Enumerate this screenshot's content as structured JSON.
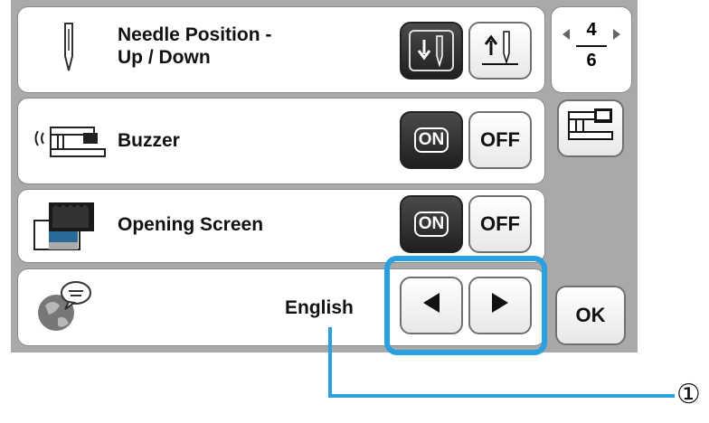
{
  "rows": {
    "needle": {
      "label_line1": "Needle Position -",
      "label_line2": "Up / Down"
    },
    "buzzer": {
      "label": "Buzzer",
      "on": "ON",
      "off": "OFF"
    },
    "opening": {
      "label": "Opening Screen",
      "on": "ON",
      "off": "OFF"
    },
    "language": {
      "value": "English"
    }
  },
  "page": {
    "current": "4",
    "total": "6"
  },
  "ok_label": "OK",
  "callout": {
    "number": "①"
  },
  "colors": {
    "highlight": "#2aa0e0",
    "screen_bg": "#a9a9a9",
    "dark_button": "#2a2a2a"
  },
  "icons": {
    "needle": "needle-icon",
    "buzzer": "machine-sound-icon",
    "opening": "opening-screen-icon",
    "language": "globe-speech-icon",
    "needle_down": "needle-down-icon",
    "needle_up": "needle-up-icon",
    "machine": "machine-settings-icon",
    "prev": "triangle-left-icon",
    "next": "triangle-right-icon"
  }
}
